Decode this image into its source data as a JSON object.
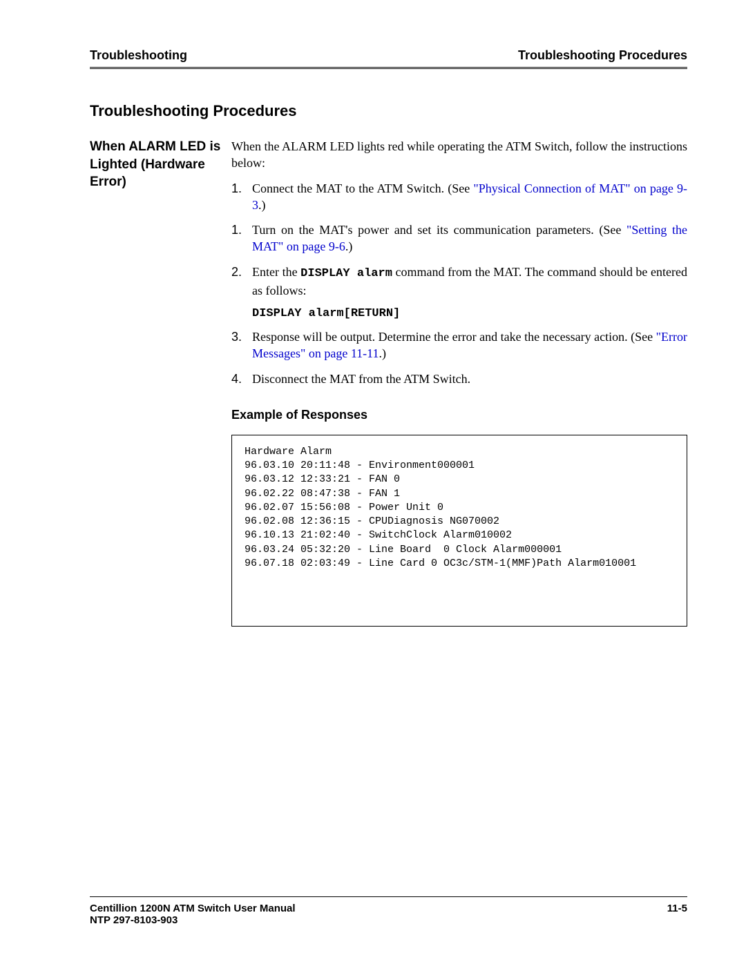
{
  "header": {
    "left": "Troubleshooting",
    "right": "Troubleshooting Procedures"
  },
  "section_title": "Troubleshooting Procedures",
  "side_heading": "When ALARM LED is Lighted (Hardware Error)",
  "intro": "When the ALARM LED lights red while operating the ATM Switch, follow the instructions below:",
  "steps": [
    {
      "num": "1.",
      "text_a": "Connect the MAT to the ATM Switch. (See  ",
      "link": "\"Physical Connection of MAT\" on page 9-3",
      "text_b": ".)"
    },
    {
      "num": "1.",
      "text_a": "Turn on the MAT's power and set its communication parameters. (See  ",
      "link": "\"Setting the MAT\" on page 9-6",
      "text_b": ".)"
    },
    {
      "num": "2.",
      "text_a": "Enter the ",
      "mono": "DISPLAY alarm",
      "text_b": " command from the MAT. The command should be entered as follows:"
    },
    {
      "num": "3.",
      "text_a": "Response will be output. Determine the error and take the necessary action. (See ",
      "link": "\"Error Messages\" on page 11-11",
      "text_b": ".)"
    },
    {
      "num": "4.",
      "text_a": "Disconnect the MAT from the ATM Switch."
    }
  ],
  "command_line": "DISPLAY alarm[RETURN]",
  "subhead": "Example of Responses",
  "responses": "Hardware Alarm\n96.03.10 20:11:48 - Environment000001\n96.03.12 12:33:21 - FAN 0\n96.02.22 08:47:38 - FAN 1\n96.02.07 15:56:08 - Power Unit 0\n96.02.08 12:36:15 - CPUDiagnosis NG070002\n96.10.13 21:02:40 - SwitchClock Alarm010002\n96.03.24 05:32:20 - Line Board  0 Clock Alarm000001\n96.07.18 02:03:49 - Line Card 0 OC3c/STM-1(MMF)Path Alarm010001",
  "footer": {
    "left_line1": "Centillion 1200N ATM Switch User Manual",
    "left_line2": "NTP 297-8103-903",
    "right": "11-5"
  }
}
